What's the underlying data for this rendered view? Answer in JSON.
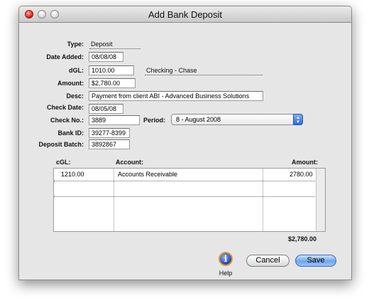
{
  "window": {
    "title": "Add Bank Deposit"
  },
  "form": {
    "type_label": "Type:",
    "type_value": "Deposit",
    "date_added_label": "Date Added:",
    "date_added_value": "08/08/08",
    "dgl_label": "dGL:",
    "dgl_value": "1010.00",
    "dgl_account_name": "Checking - Chase",
    "amount_label": "Amount:",
    "amount_value": "$2,780.00",
    "desc_label": "Desc:",
    "desc_value": "Payment from client ABI - Advanced Business Solutions",
    "check_date_label": "Check Date:",
    "check_date_value": "08/05/08",
    "check_no_label": "Check No.:",
    "check_no_value": "3889",
    "period_label": "Period:",
    "period_value": "8 - August 2008",
    "bank_id_label": "Bank ID:",
    "bank_id_value": "39277-8399",
    "deposit_batch_label": "Deposit Batch:",
    "deposit_batch_value": "3892867"
  },
  "table": {
    "headers": [
      "cGL:",
      "Account:",
      "Amount:"
    ],
    "rows": [
      {
        "cgl": "1210.00",
        "account": "Accounts Receivable",
        "amount": "2780.00"
      }
    ],
    "total": "$2,780.00"
  },
  "buttons": {
    "help": "Help",
    "cancel": "Cancel",
    "save": "Save"
  }
}
